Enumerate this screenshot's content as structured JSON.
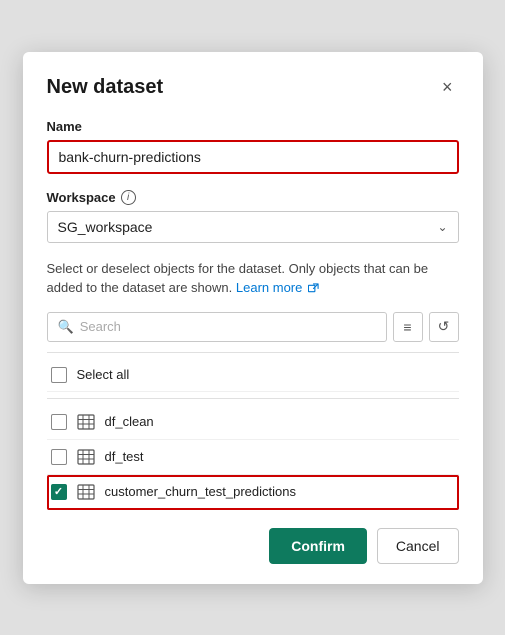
{
  "modal": {
    "title": "New dataset",
    "close_label": "×"
  },
  "name_field": {
    "label": "Name",
    "value": "bank-churn-predictions"
  },
  "workspace_field": {
    "label": "Workspace",
    "info_tooltip": "i",
    "selected": "SG_workspace"
  },
  "description": {
    "text": "Select or deselect objects for the dataset. Only objects that can be added to the dataset are shown.",
    "link_text": "Learn more",
    "link_icon": "↗"
  },
  "search": {
    "placeholder": "Search",
    "filter_icon": "≡",
    "refresh_icon": "↺"
  },
  "select_all": {
    "label": "Select all"
  },
  "objects": [
    {
      "name": "df_clean",
      "checked": false
    },
    {
      "name": "df_test",
      "checked": false
    },
    {
      "name": "customer_churn_test_predictions",
      "checked": true
    }
  ],
  "footer": {
    "confirm_label": "Confirm",
    "cancel_label": "Cancel"
  }
}
